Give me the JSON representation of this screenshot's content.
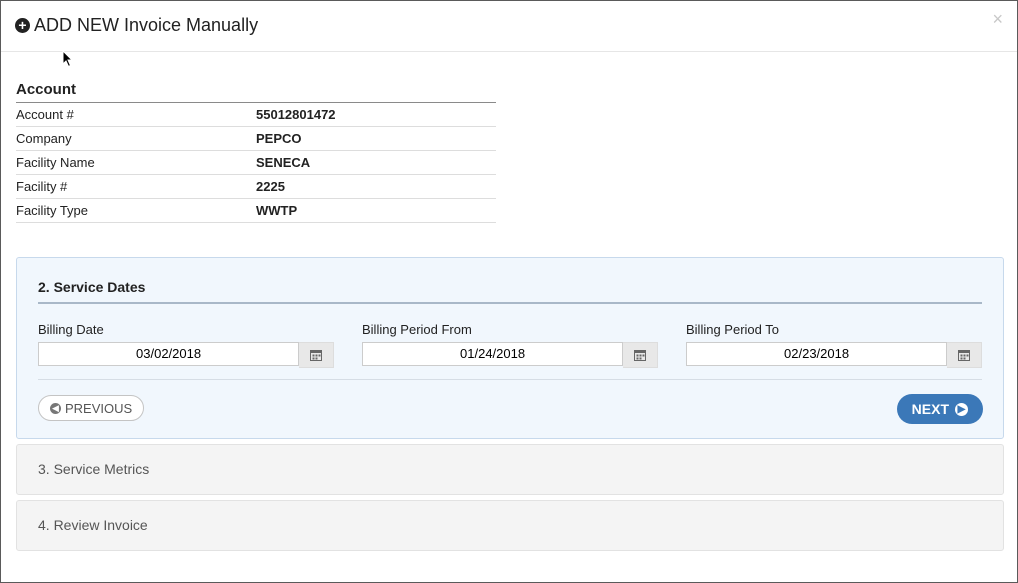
{
  "modal": {
    "title": "ADD NEW Invoice Manually",
    "close_symbol": "×"
  },
  "account": {
    "heading": "Account",
    "rows": [
      {
        "label": "Account #",
        "value": "55012801472"
      },
      {
        "label": "Company",
        "value": "PEPCO"
      },
      {
        "label": "Facility Name",
        "value": "SENECA"
      },
      {
        "label": "Facility #",
        "value": "2225"
      },
      {
        "label": "Facility Type",
        "value": "WWTP"
      }
    ]
  },
  "service_dates": {
    "heading": "2. Service Dates",
    "fields": [
      {
        "label": "Billing Date",
        "value": "03/02/2018"
      },
      {
        "label": "Billing Period From",
        "value": "01/24/2018"
      },
      {
        "label": "Billing Period To",
        "value": "02/23/2018"
      }
    ],
    "previous_label": "PREVIOUS",
    "next_label": "NEXT",
    "accent": "#3b78b8"
  },
  "collapsed_steps": [
    {
      "label": "3. Service Metrics"
    },
    {
      "label": "4. Review Invoice"
    }
  ],
  "icons": [
    "plus-circle-icon",
    "close-icon",
    "calendar-icon",
    "arrow-left-circle-icon",
    "arrow-right-circle-icon",
    "mouse-cursor-icon"
  ]
}
